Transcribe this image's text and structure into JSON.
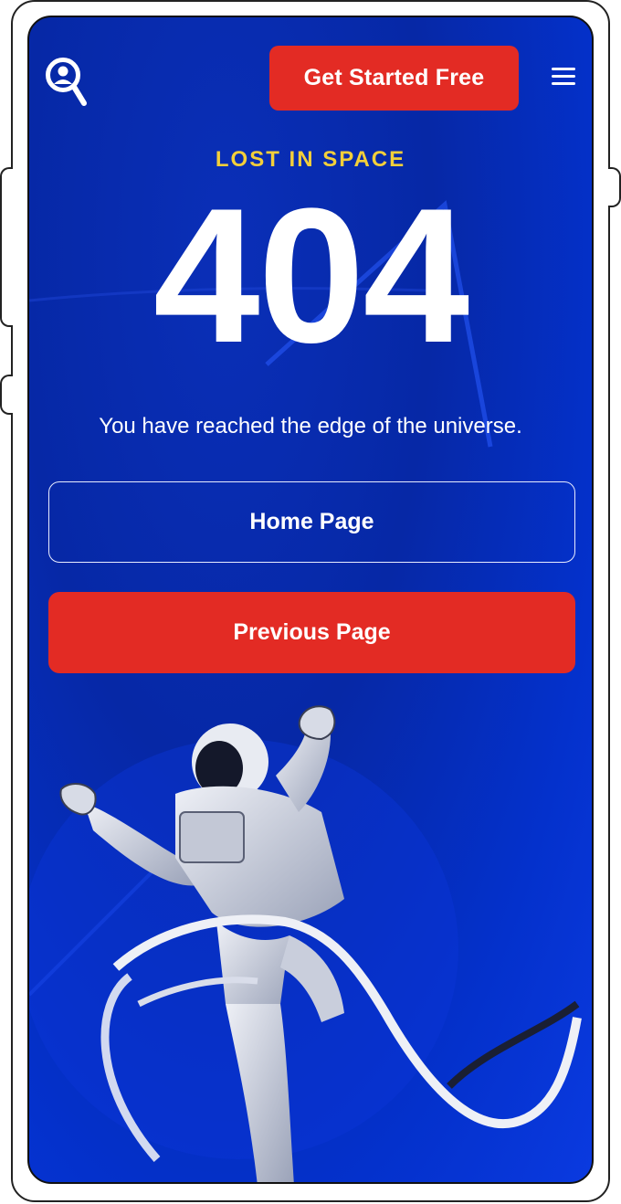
{
  "header": {
    "cta_label": "Get Started Free",
    "logo_icon": "search-person-icon",
    "menu_icon": "hamburger-menu-icon"
  },
  "error": {
    "eyebrow": "LOST IN SPACE",
    "code": "404",
    "message": "You have reached the edge of the universe."
  },
  "actions": {
    "home_label": "Home Page",
    "previous_label": "Previous Page"
  },
  "illustration": {
    "name": "astronaut-illustration"
  },
  "colors": {
    "background": "#0628a6",
    "accent_red": "#e32b24",
    "eyebrow_yellow": "#f3cf3a",
    "text_white": "#ffffff"
  }
}
